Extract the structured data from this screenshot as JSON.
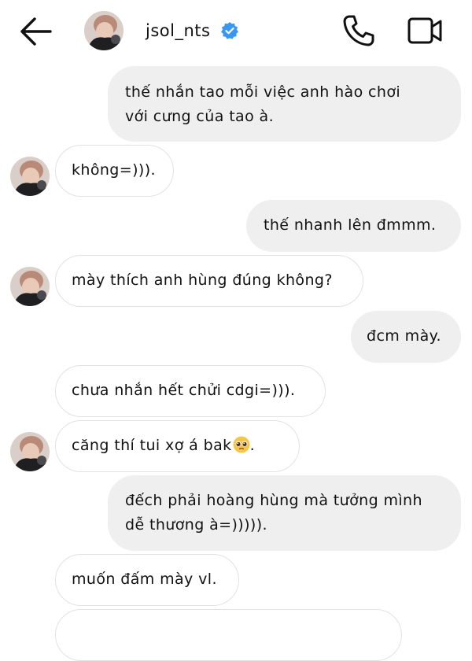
{
  "header": {
    "username": "jsol_nts",
    "icons": {
      "back": "arrow-left-icon",
      "verified": "verified-badge-icon",
      "call": "phone-icon",
      "video": "video-camera-icon"
    },
    "colors": {
      "verified": "#3897f0"
    }
  },
  "messages": [
    {
      "direction": "outgoing",
      "lines": [
        "thế nhắn tao mỗi việc anh hào chơi",
        "với cưng của tao à."
      ]
    },
    {
      "direction": "incoming",
      "lines": [
        "không=)))."
      ]
    },
    {
      "direction": "outgoing",
      "lines": [
        "thế nhanh lên đmmm."
      ]
    },
    {
      "direction": "incoming",
      "lines": [
        "mày thích anh hùng đúng không?"
      ]
    },
    {
      "direction": "outgoing",
      "lines": [
        "đcm mày."
      ]
    },
    {
      "direction": "incoming",
      "lines": [
        "chưa nhắn hết chửi cdgi=)))."
      ]
    },
    {
      "direction": "incoming",
      "lines": [
        "căng thí tui xợ á bak",
        "."
      ],
      "emoji": "pleading-face-emoji"
    },
    {
      "direction": "outgoing",
      "lines": [
        "đếch phải hoàng hùng mà tưởng mình",
        "dễ thương à=)))))."
      ]
    },
    {
      "direction": "incoming",
      "lines": [
        "muốn đấm mày vl."
      ]
    }
  ],
  "colors": {
    "outgoing_bubble": "#efefef",
    "incoming_border": "#e2e2e2"
  }
}
